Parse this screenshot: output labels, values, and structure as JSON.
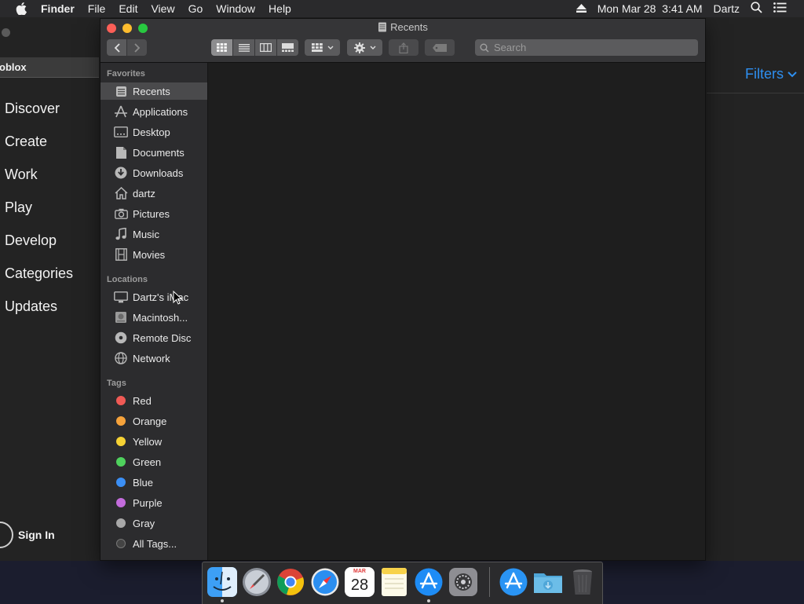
{
  "menubar": {
    "app_name": "Finder",
    "menus": [
      "File",
      "Edit",
      "View",
      "Go",
      "Window",
      "Help"
    ],
    "clock": "Mon Mar 28  3:41 AM",
    "user": "Dartz"
  },
  "background_app": {
    "tab_label": "oblox",
    "nav": [
      "Discover",
      "Create",
      "Work",
      "Play",
      "Develop",
      "Categories",
      "Updates"
    ],
    "sign_in": "Sign In",
    "filters": "Filters"
  },
  "finder": {
    "title": "Recents",
    "search_placeholder": "Search",
    "favorites_heading": "Favorites",
    "favorites": [
      {
        "label": "Recents",
        "icon": "recents-icon"
      },
      {
        "label": "Applications",
        "icon": "applications-icon"
      },
      {
        "label": "Desktop",
        "icon": "desktop-icon"
      },
      {
        "label": "Documents",
        "icon": "documents-icon"
      },
      {
        "label": "Downloads",
        "icon": "downloads-icon"
      },
      {
        "label": "dartz",
        "icon": "home-icon"
      },
      {
        "label": "Pictures",
        "icon": "camera-icon"
      },
      {
        "label": "Music",
        "icon": "music-note-icon"
      },
      {
        "label": "Movies",
        "icon": "film-icon"
      }
    ],
    "locations_heading": "Locations",
    "locations": [
      {
        "label": "Dartz's iMac",
        "icon": "imac-icon"
      },
      {
        "label": "Macintosh...",
        "icon": "hard-drive-icon"
      },
      {
        "label": "Remote Disc",
        "icon": "disc-icon"
      },
      {
        "label": "Network",
        "icon": "globe-icon"
      }
    ],
    "tags_heading": "Tags",
    "tags": [
      {
        "label": "Red",
        "color": "#f05a55"
      },
      {
        "label": "Orange",
        "color": "#f6a33b"
      },
      {
        "label": "Yellow",
        "color": "#f6d234"
      },
      {
        "label": "Green",
        "color": "#4fd15d"
      },
      {
        "label": "Blue",
        "color": "#3b8ff5"
      },
      {
        "label": "Purple",
        "color": "#c36cdc"
      },
      {
        "label": "Gray",
        "color": "#a8a8a8"
      }
    ],
    "all_tags": "All Tags..."
  },
  "dock": {
    "items": [
      "finder-icon",
      "launchpad-icon",
      "chrome-icon",
      "safari-icon",
      "calendar-icon",
      "notes-icon",
      "app-store-icon",
      "system-preferences-icon",
      "app-store-download-icon",
      "downloads-folder-icon",
      "trash-icon"
    ],
    "calendar_month": "MAR",
    "calendar_day": "28"
  }
}
